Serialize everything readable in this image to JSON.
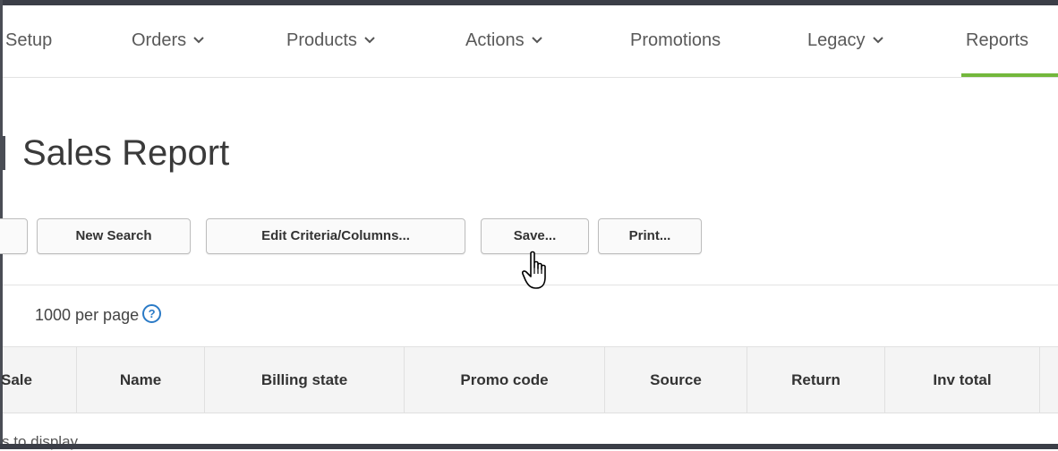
{
  "nav": {
    "items": [
      {
        "label": "Setup",
        "has_dropdown": false
      },
      {
        "label": "Orders",
        "has_dropdown": true
      },
      {
        "label": "Products",
        "has_dropdown": true
      },
      {
        "label": "Actions",
        "has_dropdown": true
      },
      {
        "label": "Promotions",
        "has_dropdown": false
      },
      {
        "label": "Legacy",
        "has_dropdown": true
      },
      {
        "label": "Reports",
        "has_dropdown": false,
        "active": true
      }
    ],
    "active_color": "#73b73c"
  },
  "page": {
    "title": "Sales Report"
  },
  "toolbar": {
    "partial_label": "",
    "new_search_label": "New Search",
    "edit_label": "Edit Criteria/Columns...",
    "save_label": "Save...",
    "print_label": "Print..."
  },
  "pagination": {
    "per_page_label": "1000 per page",
    "help_icon": "question-circle-icon"
  },
  "table": {
    "columns": [
      "Sale",
      "Name",
      "Billing state",
      "Promo code",
      "Source",
      "Return",
      "Inv total"
    ],
    "empty_message": "s to display"
  }
}
